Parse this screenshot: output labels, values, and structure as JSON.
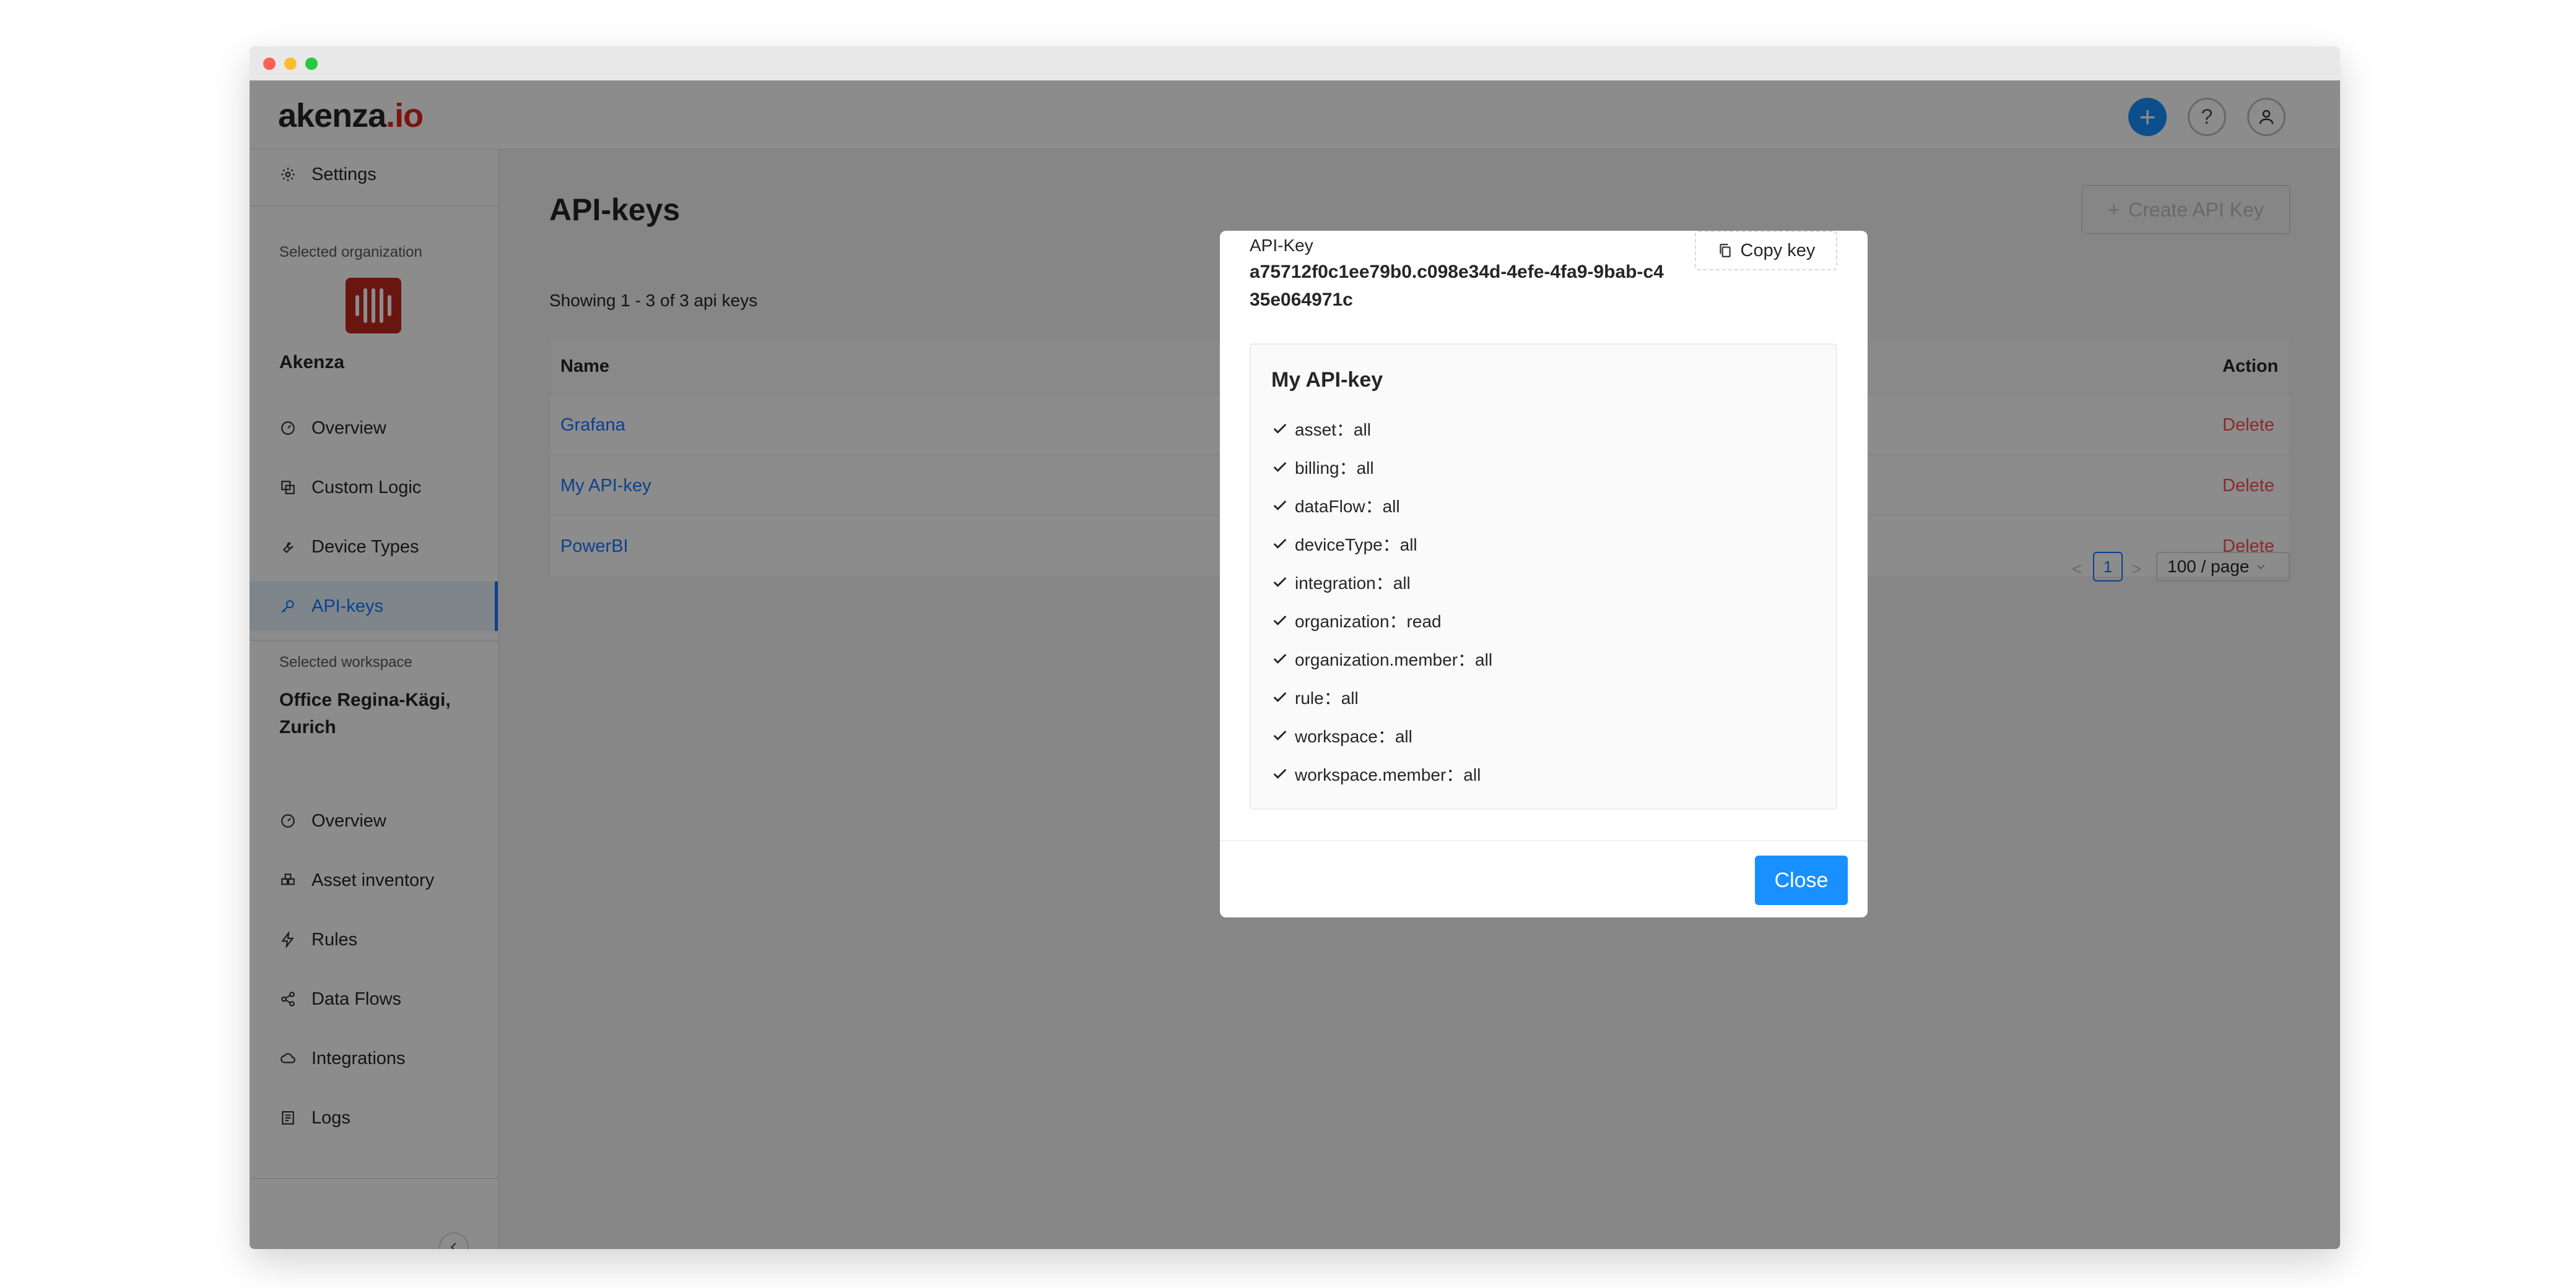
{
  "app": {
    "logo_main": "akenza",
    "logo_suffix": ".io",
    "header": {
      "plus_icon": "plus-icon",
      "help_label": "?",
      "user_icon": "user-icon"
    }
  },
  "sidebar": {
    "settings_label": "Settings",
    "org_section_label": "Selected organization",
    "org_name": "Akenza",
    "org_items": [
      {
        "label": "Overview",
        "icon": "dashboard-icon"
      },
      {
        "label": "Custom Logic",
        "icon": "code-block-icon"
      },
      {
        "label": "Device Types",
        "icon": "wrench-icon"
      },
      {
        "label": "API-keys",
        "icon": "key-icon",
        "active": true
      }
    ],
    "workspace_section_label": "Selected workspace",
    "workspace_name": "Office Regina-Kägi, Zurich",
    "workspace_items": [
      {
        "label": "Overview",
        "icon": "dashboard-icon"
      },
      {
        "label": "Asset inventory",
        "icon": "inventory-icon"
      },
      {
        "label": "Rules",
        "icon": "lightning-icon"
      },
      {
        "label": "Data Flows",
        "icon": "share-icon"
      },
      {
        "label": "Integrations",
        "icon": "cloud-icon"
      },
      {
        "label": "Logs",
        "icon": "log-icon"
      }
    ]
  },
  "main": {
    "title": "API-keys",
    "create_button": "Create API Key",
    "showing_text": "Showing 1 - 3 of 3 api keys",
    "table": {
      "columns": [
        "Name",
        "Action"
      ],
      "rows": [
        {
          "name": "Grafana",
          "action": "Delete"
        },
        {
          "name": "My API-key",
          "action": "Delete"
        },
        {
          "name": "PowerBI",
          "action": "Delete"
        }
      ]
    },
    "pagination": {
      "prev": "<",
      "current_page": "1",
      "next": ">",
      "page_size": "100 / page"
    }
  },
  "modal": {
    "key_label": "API-Key",
    "key_value": "a75712f0c1ee79b0.c098e34d-4efe-4fa9-9bab-c435e064971c",
    "copy_button": "Copy key",
    "permissions_title": "My API-key",
    "permissions": [
      "asset：all",
      "billing：all",
      "dataFlow：all",
      "deviceType：all",
      "integration：all",
      "organization：read",
      "organization.member：all",
      "rule：all",
      "workspace：all",
      "workspace.member：all"
    ],
    "close_button": "Close"
  },
  "colors": {
    "primary": "#1890ff",
    "link": "#1677ff",
    "danger": "#ff4d4f",
    "brand_red": "#e2231a",
    "overlay": "rgba(0,0,0,0.45)"
  }
}
